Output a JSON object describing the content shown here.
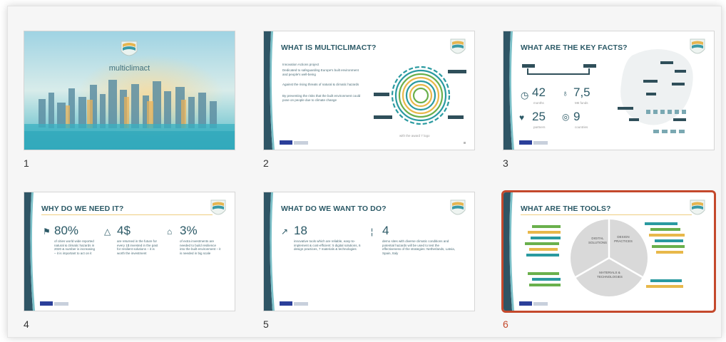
{
  "slides": [
    {
      "number": "1",
      "logo_text": "multiclimact"
    },
    {
      "number": "2",
      "title": "WHAT IS MULTICLIMACT?",
      "bullets": [
        "Innovation Actions project",
        "Dedicated to safeguarding Europe's built environment and people's well-being",
        "Against the rising threats of natural & climatic hazards",
        "By preventing the risks that the built environment could pose on people due to climate change"
      ],
      "caption": "with the award 7 logo"
    },
    {
      "number": "3",
      "title": "WHAT ARE THE KEY FACTS?",
      "stats": [
        {
          "value": "42",
          "label": "months"
        },
        {
          "value": "7,5",
          "label": "M€ funds"
        },
        {
          "value": "25",
          "label": "partners"
        },
        {
          "value": "9",
          "label": "countries"
        }
      ]
    },
    {
      "number": "4",
      "title": "WHY DO WE NEED IT?",
      "stats": [
        {
          "value": "80%",
          "text": "of cities world wide reported natural & climatic hazards in 2020 & number is increasing – it is important to act on it"
        },
        {
          "value": "4$",
          "text": "are returned in the future for every 1$ invested in the past for resilient solutions – it is worth the investment"
        },
        {
          "value": "3%",
          "text": "of extra investments are needed to build resilience into the built environment – it is needed in big scale"
        }
      ]
    },
    {
      "number": "5",
      "title": "WHAT DO WE WANT TO DO?",
      "stats": [
        {
          "value": "18",
          "text": "innovative tools which are reliable, easy-to-implement & cost-efficient: 5 digital solutions, 6 design practices, 7 materials & technologies"
        },
        {
          "value": "4",
          "text": "demo sites with diverse climatic conditions and potential hazards will be used to test the effectiveness of the strategies: Netherlands, Latvia, Spain, Italy"
        }
      ]
    },
    {
      "number": "6",
      "title": "WHAT ARE THE TOOLS?",
      "pie_labels": [
        "DIGITAL SOLUTIONS",
        "DESIGN PRACTICES",
        "MATERIALS & TECHNOLOGIES"
      ],
      "selected": true
    }
  ],
  "colors": {
    "selected_border": "#c4492c",
    "title": "#2b5966",
    "accent_teal": "#2a9aa0",
    "accent_green": "#6ab04c",
    "accent_yellow": "#e8b84a"
  }
}
